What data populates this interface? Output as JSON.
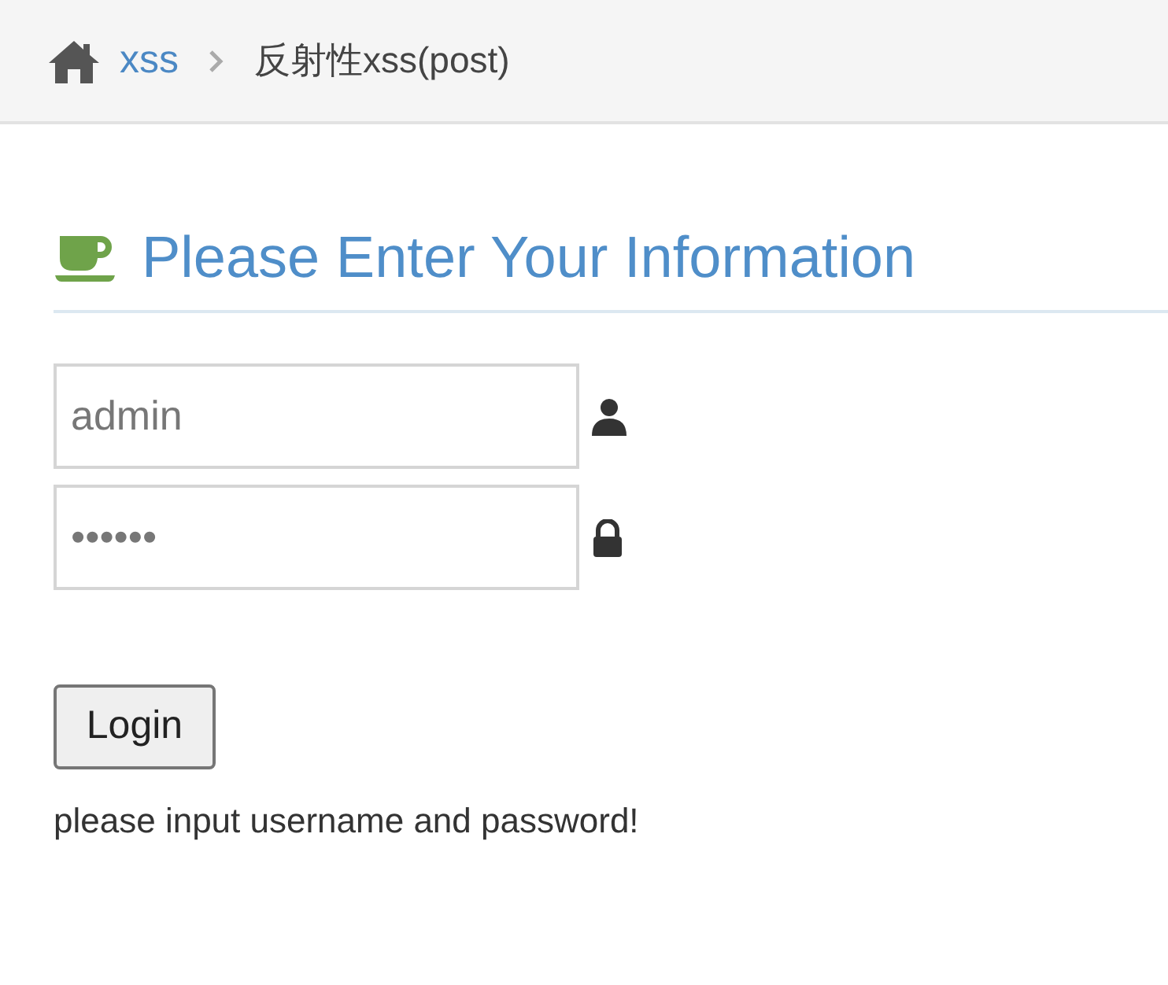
{
  "breadcrumb": {
    "items": [
      {
        "label": "xss",
        "kind": "link"
      },
      {
        "label": "反射性xss(post)",
        "kind": "current"
      }
    ]
  },
  "heading": "Please Enter Your Information",
  "fields": [
    {
      "value": "admin",
      "kind": "user"
    },
    {
      "value": "••••••",
      "kind": "lock"
    }
  ],
  "login_button": "Login",
  "message": "please input username and password!"
}
